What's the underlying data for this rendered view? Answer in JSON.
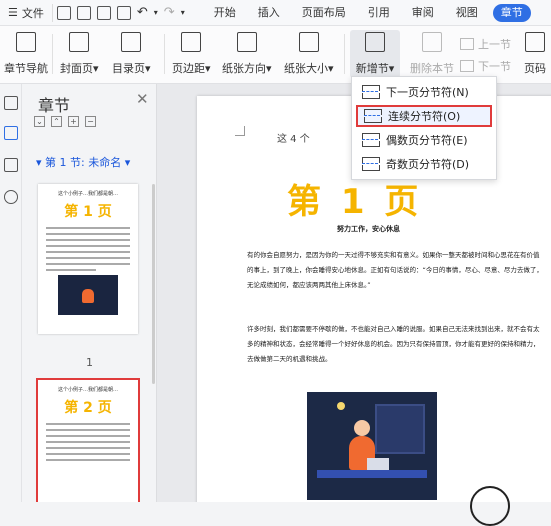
{
  "menubar": {
    "file_label": "文件",
    "tabs": [
      "开始",
      "插入",
      "页面布局",
      "引用",
      "审阅",
      "视图"
    ],
    "active_pill": "章节"
  },
  "ribbon": {
    "chapter_nav": "章节导航",
    "cover": "封面页",
    "toc": "目录页",
    "margin": "页边距",
    "orientation": "纸张方向",
    "size": "纸张大小",
    "new_section": "新增节",
    "delete_section": "删除本节",
    "prev_section": "上一节",
    "next_section": "下一节",
    "page_code": "页码"
  },
  "panel": {
    "title": "章节",
    "section_label": "第 1 节: 未命名",
    "thumb1": {
      "header": "这个小例子…我们都是朝…",
      "big": "第 1 页",
      "num": "1"
    },
    "thumb2": {
      "header": "这个小例子…我们都是朝…",
      "big": "第 2 页"
    }
  },
  "page": {
    "header_text": "这 4 个",
    "big_title": "第 1 页",
    "subtitle": "努力工作，安心休息",
    "para1": "有的你会自愿努力，是因为你的一天过得不够充实和有意义。如果你一整天都被时间和心思花在有价值的事上，到了晚上，你会睡得安心地休息。正如有句话说的：“今日的事情，尽心、尽意、尽力去做了，无论成绩如何，都应该两两其他上床休息。”",
    "para2": "许多时刻，我们都需要不停歇的做，不也能对自己入睡的说服。如果自己无法来找到出来，就不会有太多的精神和状态，会经常睡得一个好好休息的机会。因为只有保持冒顶，你才能有更好的保持和精力，去做做第二天的机遇和挑战。"
  },
  "dropdown": {
    "items": [
      "下一页分节符(N)",
      "连续分节符(O)",
      "偶数页分节符(E)",
      "奇数页分节符(D)"
    ]
  },
  "colors": {
    "accent": "#2f6fe4",
    "highlight": "#e03b3b",
    "title_yellow": "#f5b400"
  }
}
